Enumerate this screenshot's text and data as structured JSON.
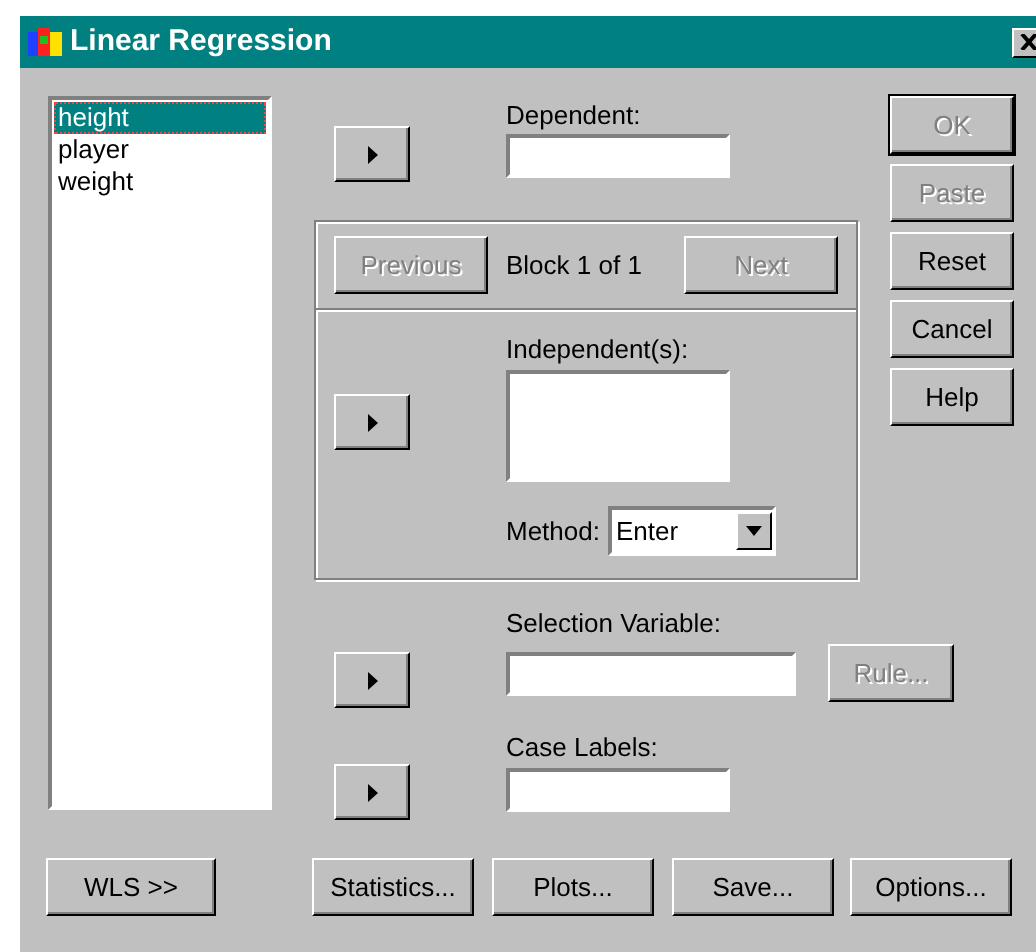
{
  "window": {
    "title": "Linear Regression"
  },
  "variables": [
    {
      "label": "height",
      "selected": true
    },
    {
      "label": "player",
      "selected": false
    },
    {
      "label": "weight",
      "selected": false
    }
  ],
  "dependent": {
    "label": "Dependent:"
  },
  "block": {
    "previous": {
      "label": "Previous",
      "disabled": true
    },
    "caption": "Block 1 of 1",
    "next": {
      "label": "Next",
      "disabled": true
    },
    "independent": {
      "label": "Independent(s):"
    },
    "method": {
      "label": "Method:",
      "value": "Enter"
    }
  },
  "selection_variable": {
    "label": "Selection Variable:"
  },
  "rule_button": {
    "label": "Rule...",
    "disabled": true
  },
  "case_labels": {
    "label": "Case Labels:"
  },
  "side_buttons": [
    {
      "label": "OK",
      "disabled": true,
      "default": true
    },
    {
      "label": "Paste",
      "disabled": true,
      "default": false
    },
    {
      "label": "Reset",
      "disabled": false,
      "default": false
    },
    {
      "label": "Cancel",
      "disabled": false,
      "default": false
    },
    {
      "label": "Help",
      "disabled": false,
      "default": false
    }
  ],
  "bottom_buttons": [
    {
      "label": "WLS >>",
      "disabled": false
    },
    {
      "label": "Statistics...",
      "disabled": false
    },
    {
      "label": "Plots...",
      "disabled": false
    },
    {
      "label": "Save...",
      "disabled": false
    },
    {
      "label": "Options...",
      "disabled": false
    }
  ]
}
